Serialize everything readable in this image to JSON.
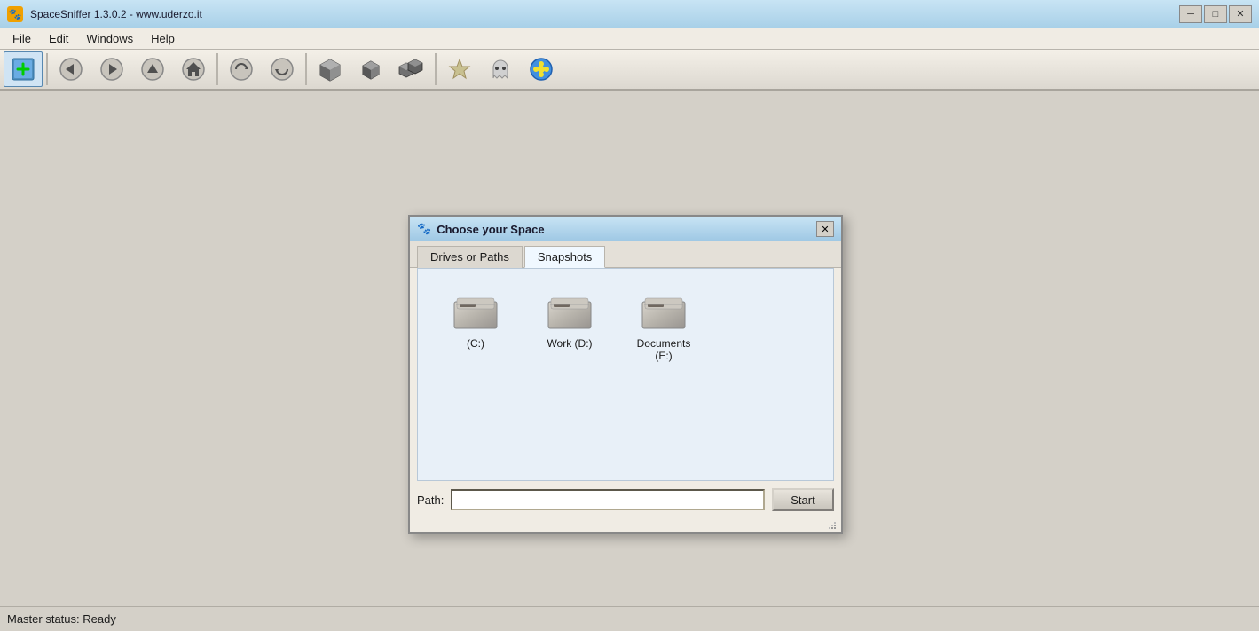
{
  "app": {
    "title": "SpaceSniffer 1.3.0.2 - www.uderzo.it",
    "title_icon": "🐾"
  },
  "title_bar": {
    "minimize_label": "─",
    "restore_label": "□",
    "close_label": "✕"
  },
  "menu": {
    "items": [
      "File",
      "Edit",
      "Windows",
      "Help"
    ]
  },
  "toolbar": {
    "buttons": [
      {
        "name": "new-tab-btn",
        "icon": "🗋+",
        "label": "New"
      },
      {
        "name": "back-btn",
        "icon": "◀",
        "label": "Back"
      },
      {
        "name": "forward-btn",
        "icon": "▶",
        "label": "Forward"
      },
      {
        "name": "up-btn",
        "icon": "↑",
        "label": "Up"
      },
      {
        "name": "home-btn",
        "icon": "⌂",
        "label": "Home"
      },
      {
        "name": "refresh-btn",
        "icon": "↺",
        "label": "Refresh"
      },
      {
        "name": "refresh2-btn",
        "icon": "↻",
        "label": "Refresh2"
      },
      {
        "name": "box1-btn",
        "icon": "◼",
        "label": "Box1"
      },
      {
        "name": "box2-btn",
        "icon": "▪",
        "label": "Box2"
      },
      {
        "name": "boxes-btn",
        "icon": "⬛",
        "label": "Boxes"
      },
      {
        "name": "star-btn",
        "icon": "☆",
        "label": "Star"
      },
      {
        "name": "ghost-btn",
        "icon": "👻",
        "label": "Ghost"
      },
      {
        "name": "flower-btn",
        "icon": "✿",
        "label": "Flower"
      }
    ]
  },
  "dialog": {
    "title": "Choose your Space",
    "title_icon": "🐾",
    "tabs": [
      {
        "id": "drives",
        "label": "Drives or Paths",
        "active": false
      },
      {
        "id": "snapshots",
        "label": "Snapshots",
        "active": true
      }
    ],
    "drives": [
      {
        "label": "(C:)",
        "id": "drive-c"
      },
      {
        "label": "Work (D:)",
        "id": "drive-d"
      },
      {
        "label": "Documents (E:)",
        "id": "drive-e"
      }
    ],
    "footer": {
      "path_label": "Path:",
      "path_placeholder": "",
      "start_label": "Start"
    }
  },
  "status_bar": {
    "text": "Master status: Ready"
  }
}
